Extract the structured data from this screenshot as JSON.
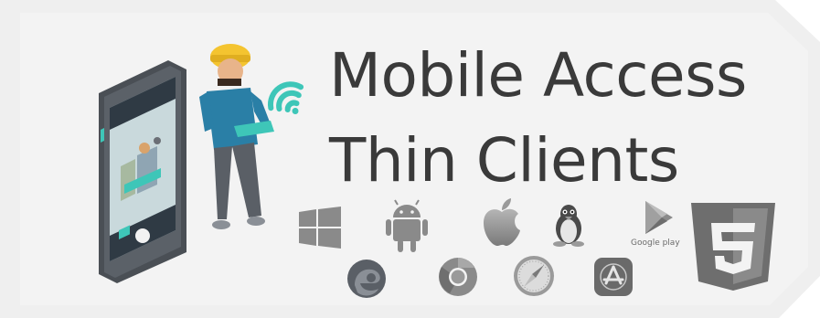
{
  "title": {
    "line1": "Mobile Access",
    "line2": "Thin Clients"
  },
  "logos": {
    "google_play_label": "Google play",
    "html5_digit": "5"
  },
  "icons": [
    "phone-illustration-icon",
    "worker-illustration-icon",
    "wifi-icon",
    "windows-icon",
    "android-icon",
    "apple-icon",
    "linux-icon",
    "google-play-icon",
    "html5-icon",
    "edge-icon",
    "chrome-icon",
    "safari-icon",
    "app-store-icon"
  ],
  "colors": {
    "background": "#efefef",
    "title": "#3a3a3a",
    "accent_teal": "#3ec6b8",
    "worker_shirt": "#2a7fa6",
    "helmet": "#f4c430",
    "logo_gray": "#8a8a8a"
  }
}
